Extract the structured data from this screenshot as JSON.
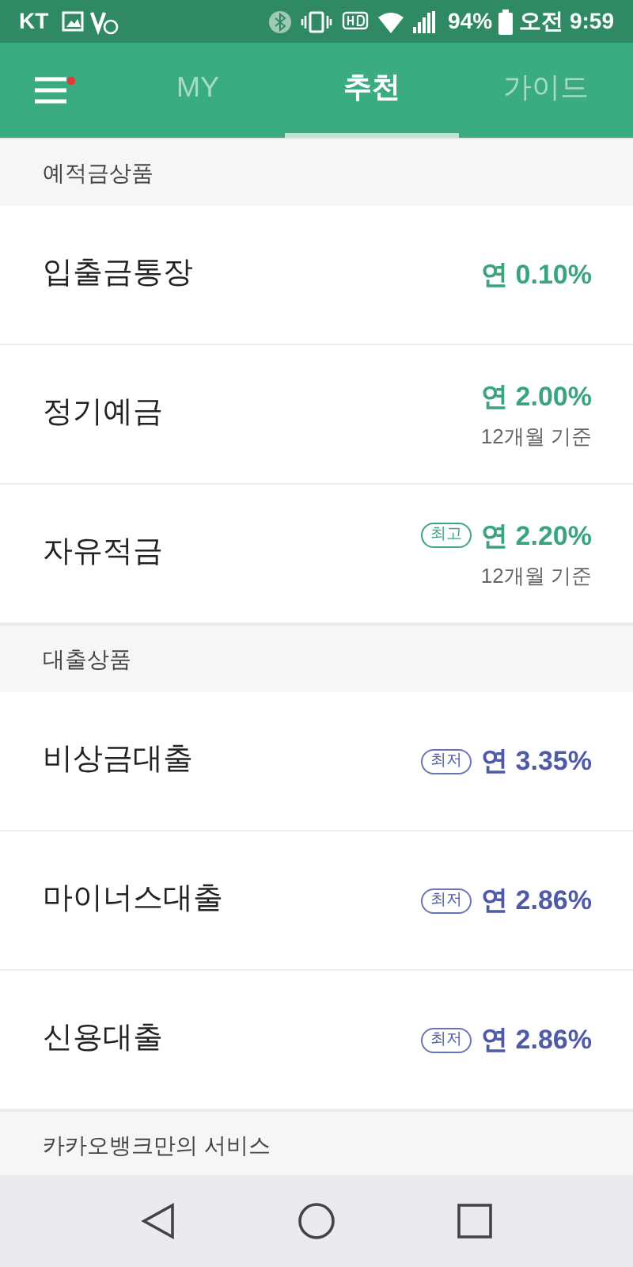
{
  "status_bar": {
    "carrier": "KT",
    "battery": "94%",
    "time": "오전 9:59"
  },
  "menu": {
    "notification": true
  },
  "tabs": [
    {
      "label": "MY",
      "selected": false
    },
    {
      "label": "추천",
      "selected": true
    },
    {
      "label": "가이드",
      "selected": false
    }
  ],
  "sections": [
    {
      "title": "예적금상품",
      "kind": "deposit",
      "items": [
        {
          "name": "입출금통장",
          "rate": "연 0.10%"
        },
        {
          "name": "정기예금",
          "rate": "연 2.00%",
          "note": "12개월 기준"
        },
        {
          "name": "자유적금",
          "badge": "최고",
          "rate": "연 2.20%",
          "note": "12개월 기준"
        }
      ]
    },
    {
      "title": "대출상품",
      "kind": "loan",
      "items": [
        {
          "name": "비상금대출",
          "badge": "최저",
          "rate": "연 3.35%"
        },
        {
          "name": "마이너스대출",
          "badge": "최저",
          "rate": "연 2.86%"
        },
        {
          "name": "신용대출",
          "badge": "최저",
          "rate": "연 2.86%"
        }
      ]
    },
    {
      "title": "카카오뱅크만의 서비스",
      "kind": "service"
    }
  ]
}
